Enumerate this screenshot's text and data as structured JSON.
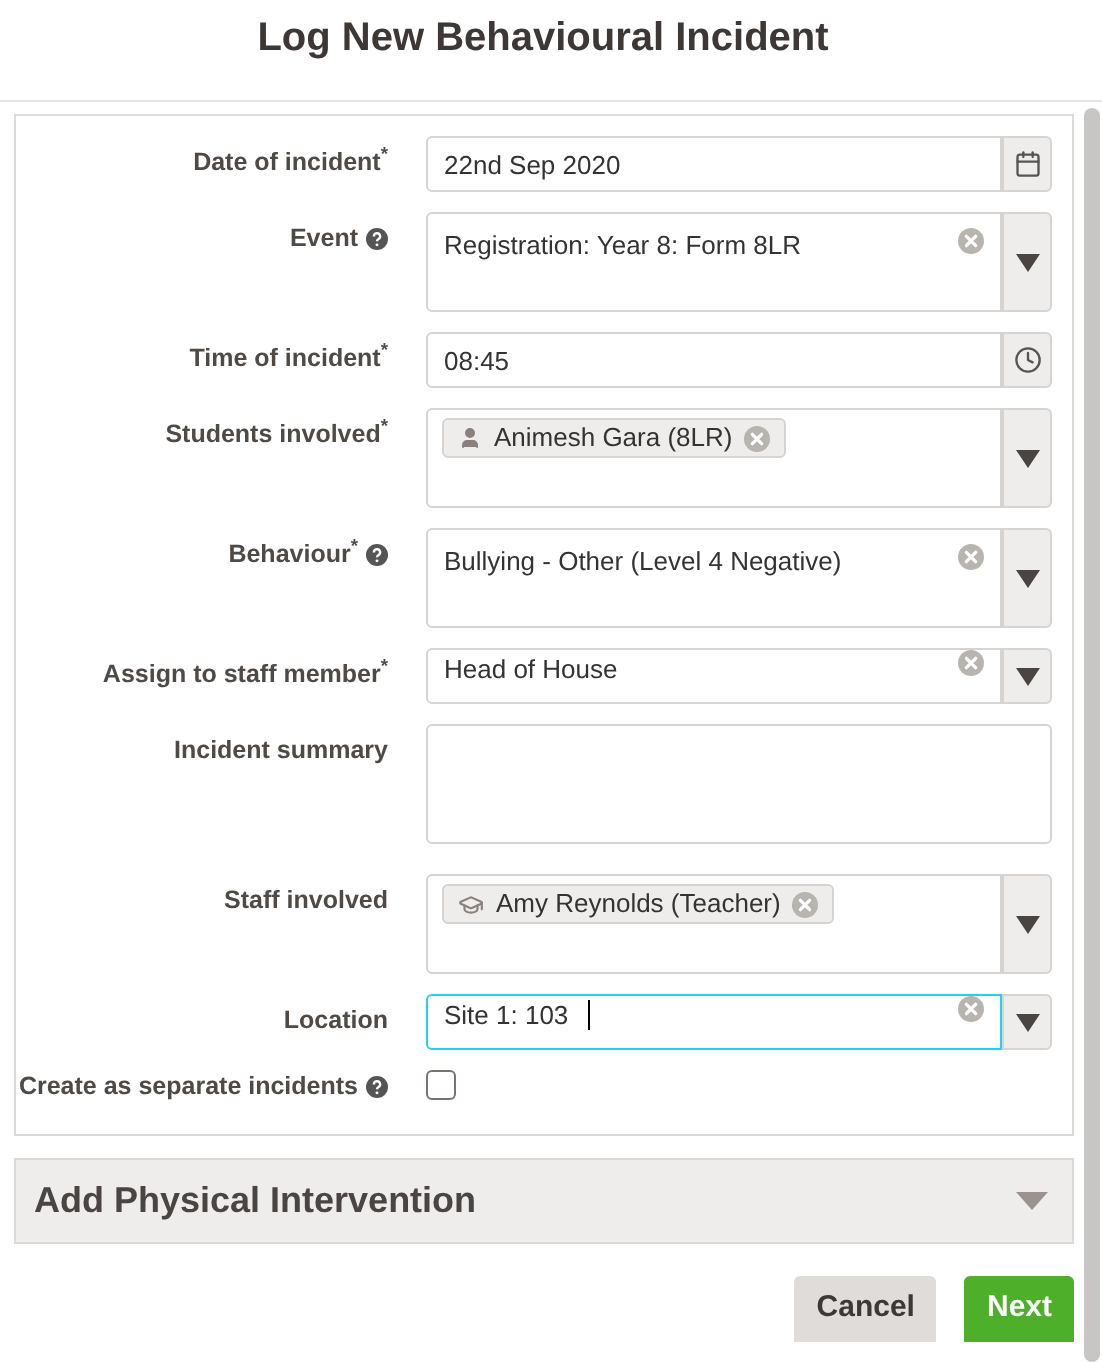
{
  "title": "Log New Behavioural Incident",
  "fields": [
    {
      "kind": "date",
      "label": "Date of incident$^{*}$",
      "help": false,
      "value": "22nd Sep 2020"
    },
    {
      "kind": "select",
      "label": "Event",
      "help": true,
      "value": "Registration: Year 8: Form 8LR",
      "tall": true
    },
    {
      "kind": "time",
      "label": "Time of incident$^{*}$",
      "help": false,
      "value": "08:45"
    },
    {
      "kind": "tags",
      "label": "Students involved$^{*}$",
      "help": false,
      "tags": [
        {
          "text": "Animesh Gara (8LR)",
          "kind": "student"
        }
      ]
    },
    {
      "kind": "select",
      "label": "Behaviour$^{*}$",
      "help": true,
      "value": "Bullying - Other (Level 4 Negative)",
      "tall": true
    },
    {
      "kind": "select",
      "label": "Assign to staff member$^{*}$",
      "help": false,
      "value": "Head of House",
      "tall": false
    },
    {
      "kind": "textarea",
      "label": "Incident summary",
      "help": false
    },
    {
      "kind": "tags",
      "label": "Staff involved",
      "help": false,
      "tags": [
        {
          "text": "Amy Reynolds (Teacher)",
          "kind": "staff"
        }
      ]
    },
    {
      "kind": "select",
      "label": "Location",
      "help": false,
      "value": "Site 1: 103",
      "tall": false,
      "focused": true
    },
    {
      "kind": "checkbox",
      "label": "Create as separate incidents",
      "help": true,
      "checked": false
    }
  ],
  "accordion": {
    "title": "Add Physical Intervention",
    "expanded": false
  },
  "buttons": [
    {
      "label": "Cancel",
      "kind": "secondary"
    },
    {
      "label": "Next",
      "kind": "primary"
    }
  ]
}
